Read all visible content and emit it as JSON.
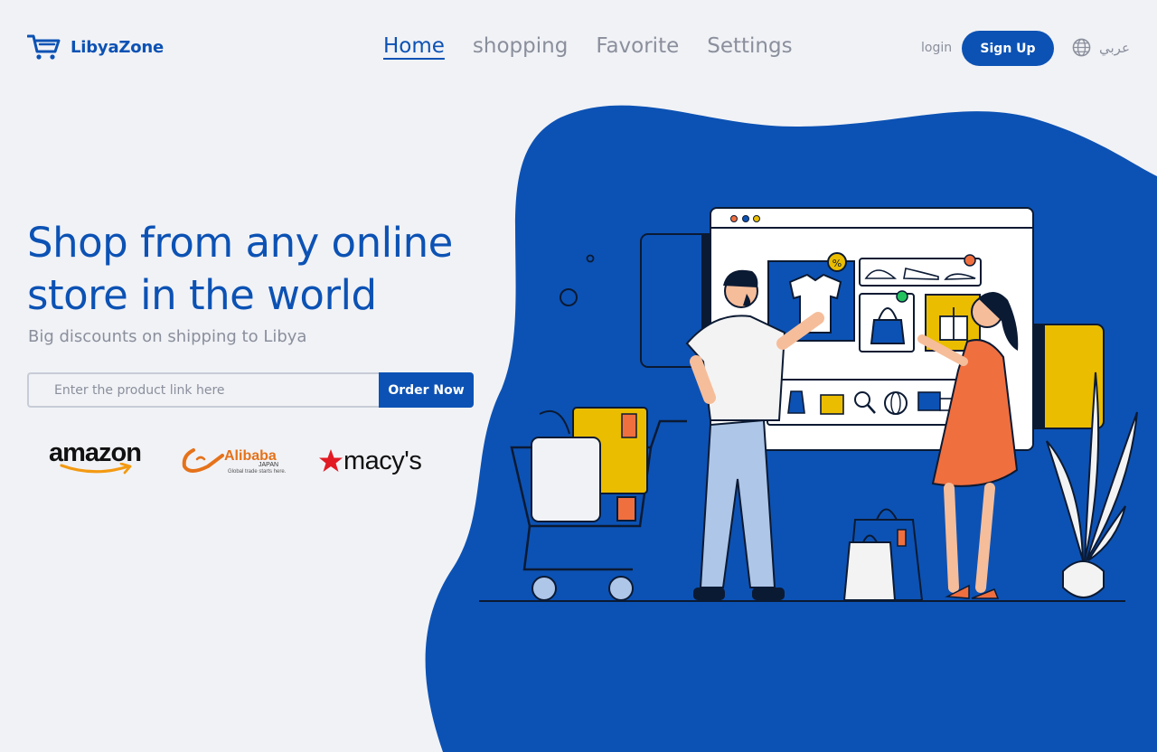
{
  "brand": {
    "name": "LibyaZone",
    "logo_icon": "cart-icon"
  },
  "nav": [
    {
      "label": "Home",
      "active": true
    },
    {
      "label": "shopping",
      "active": false
    },
    {
      "label": "Favorite",
      "active": false
    },
    {
      "label": "Settings",
      "active": false
    }
  ],
  "auth": {
    "login_label": "login",
    "signup_label": "Sign Up"
  },
  "language": {
    "icon": "globe-icon",
    "label": "عربي"
  },
  "hero": {
    "headline": "Shop from any online store in the world",
    "subline": "Big discounts on shipping to Libya",
    "input_placeholder": "Enter the product link here",
    "order_button": "Order Now"
  },
  "stores": {
    "amazon": "amazon",
    "alibaba_main": "Alibaba",
    "alibaba_sub": "JAPAN",
    "alibaba_tagline": "Global trade starts here.",
    "macys": "macy's"
  },
  "colors": {
    "accent": "#0c52b4",
    "background": "#f1f2f6",
    "muted_text": "#8a8f9c",
    "yellow": "#ebbd00",
    "orange": "#f06f3f"
  }
}
